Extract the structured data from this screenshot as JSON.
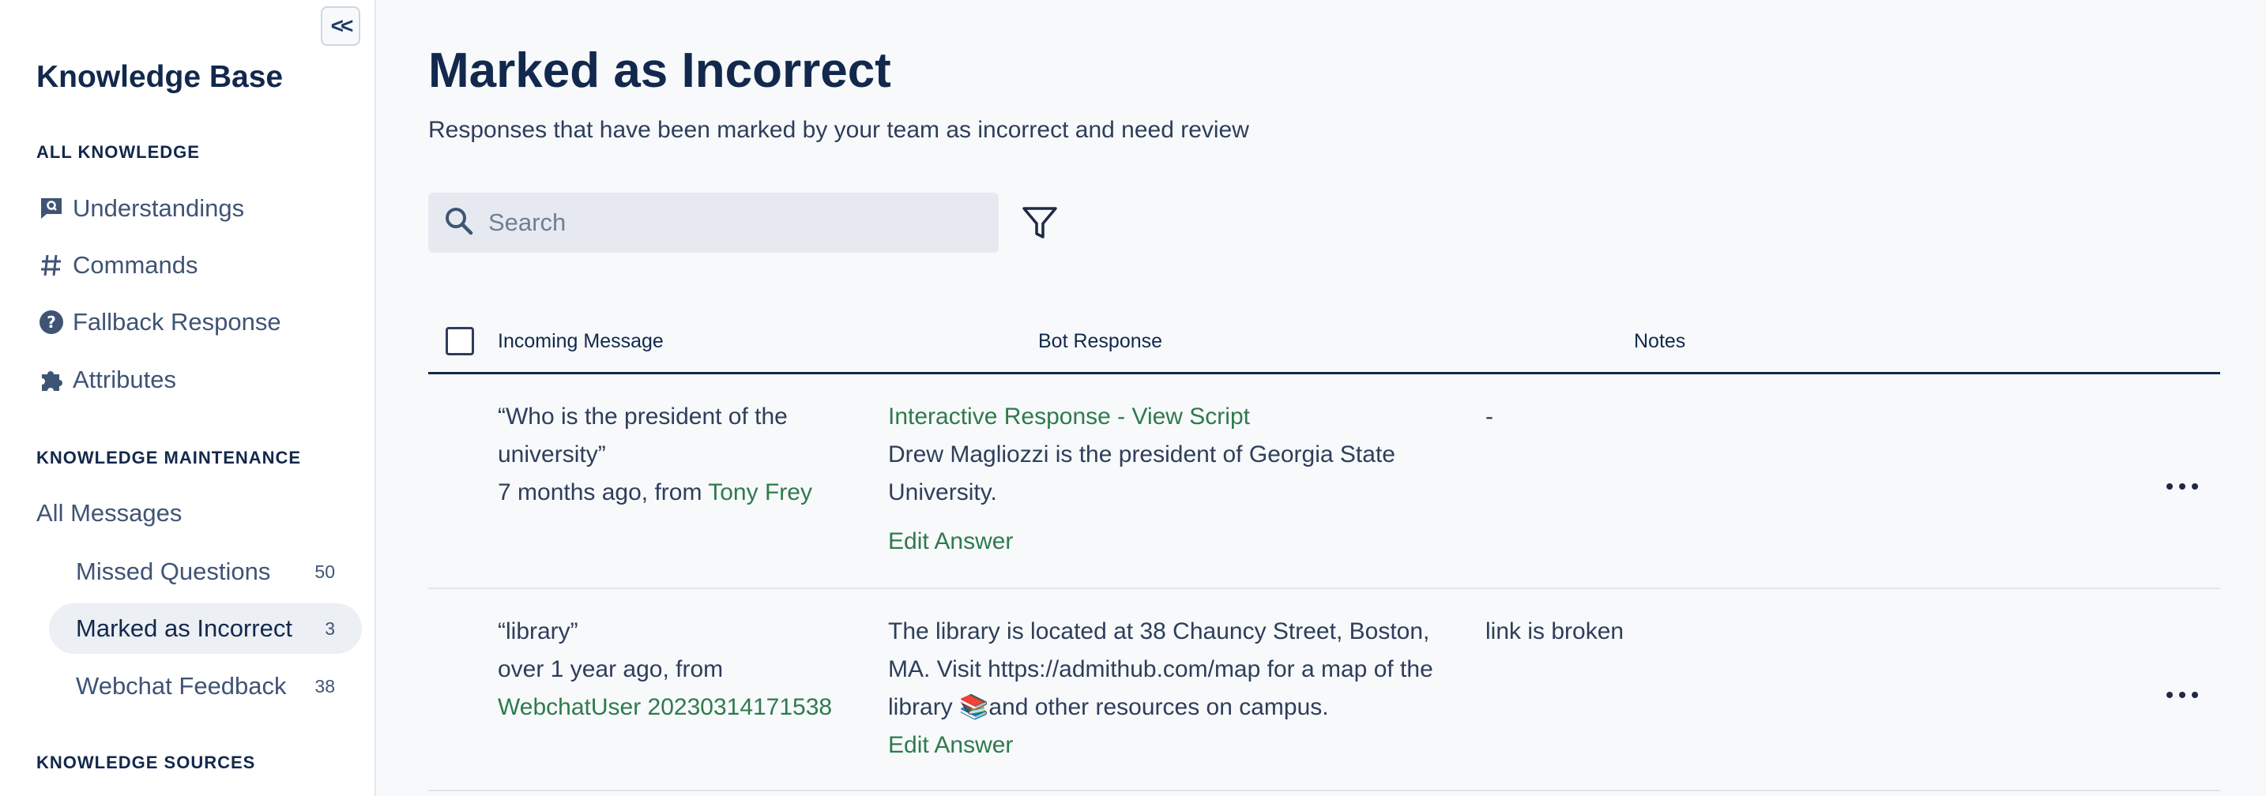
{
  "sidebar": {
    "title": "Knowledge Base",
    "collapse_label": "<<",
    "sections": {
      "all_knowledge": "ALL KNOWLEDGE",
      "knowledge_maintenance": "KNOWLEDGE MAINTENANCE",
      "knowledge_sources": "KNOWLEDGE SOURCES"
    },
    "items": {
      "understandings": "Understandings",
      "commands": "Commands",
      "fallback": "Fallback Response",
      "attributes": "Attributes",
      "all_messages": "All Messages"
    },
    "subitems": {
      "missed": {
        "label": "Missed Questions",
        "count": "50"
      },
      "incorrect": {
        "label": "Marked as Incorrect",
        "count": "3"
      },
      "webchat": {
        "label": "Webchat Feedback",
        "count": "38"
      }
    }
  },
  "main": {
    "title": "Marked as Incorrect",
    "subtitle": "Responses that have been marked by your team as incorrect and need review",
    "search_placeholder": "Search",
    "columns": {
      "incoming": "Incoming Message",
      "bot": "Bot Response",
      "notes": "Notes"
    },
    "rows": [
      {
        "message_line1": "“Who is the president of the",
        "message_line2": "university”",
        "meta_prefix": "7 months ago, from ",
        "meta_user": "Tony Frey",
        "response_link": "Interactive Response - View Script",
        "response_line1": "Drew Magliozzi is the president of Georgia State",
        "response_line2": "University.",
        "edit_label": "Edit Answer",
        "note": "-"
      },
      {
        "message_line1": "“library”",
        "meta_prefix": "over 1 year ago, from",
        "meta_user": "WebchatUser 20230314171538",
        "response_line1": "The library is located at 38 Chauncy Street, Boston,",
        "response_line2": "MA. Visit https://admithub.com/map for a map of the",
        "response_line3": "library 📚and other resources on campus.",
        "edit_label": "Edit Answer",
        "note": "link is broken"
      }
    ]
  },
  "colors": {
    "accent_green": "#2f7a4c",
    "navy": "#12284c"
  }
}
